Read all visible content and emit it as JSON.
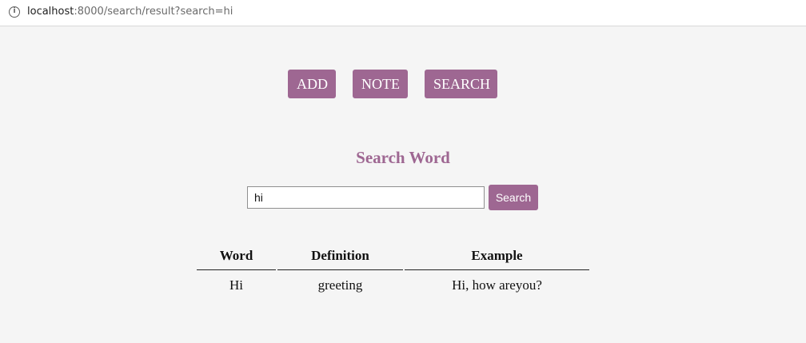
{
  "browser": {
    "url_host": "localhost",
    "url_rest": ":8000/search/result?search=hi",
    "info_icon": "i"
  },
  "nav": {
    "add_label": "ADD",
    "note_label": "NOTE",
    "search_label": "SEARCH"
  },
  "search": {
    "title": "Search Word",
    "input_value": "hi",
    "button_label": "Search"
  },
  "table": {
    "headers": [
      "Word",
      "Definition",
      "Example"
    ],
    "rows": [
      [
        "Hi",
        "greeting",
        "Hi, how areyou?"
      ]
    ]
  },
  "colors": {
    "accent": "#9e6792",
    "background": "#f5f5f5"
  }
}
